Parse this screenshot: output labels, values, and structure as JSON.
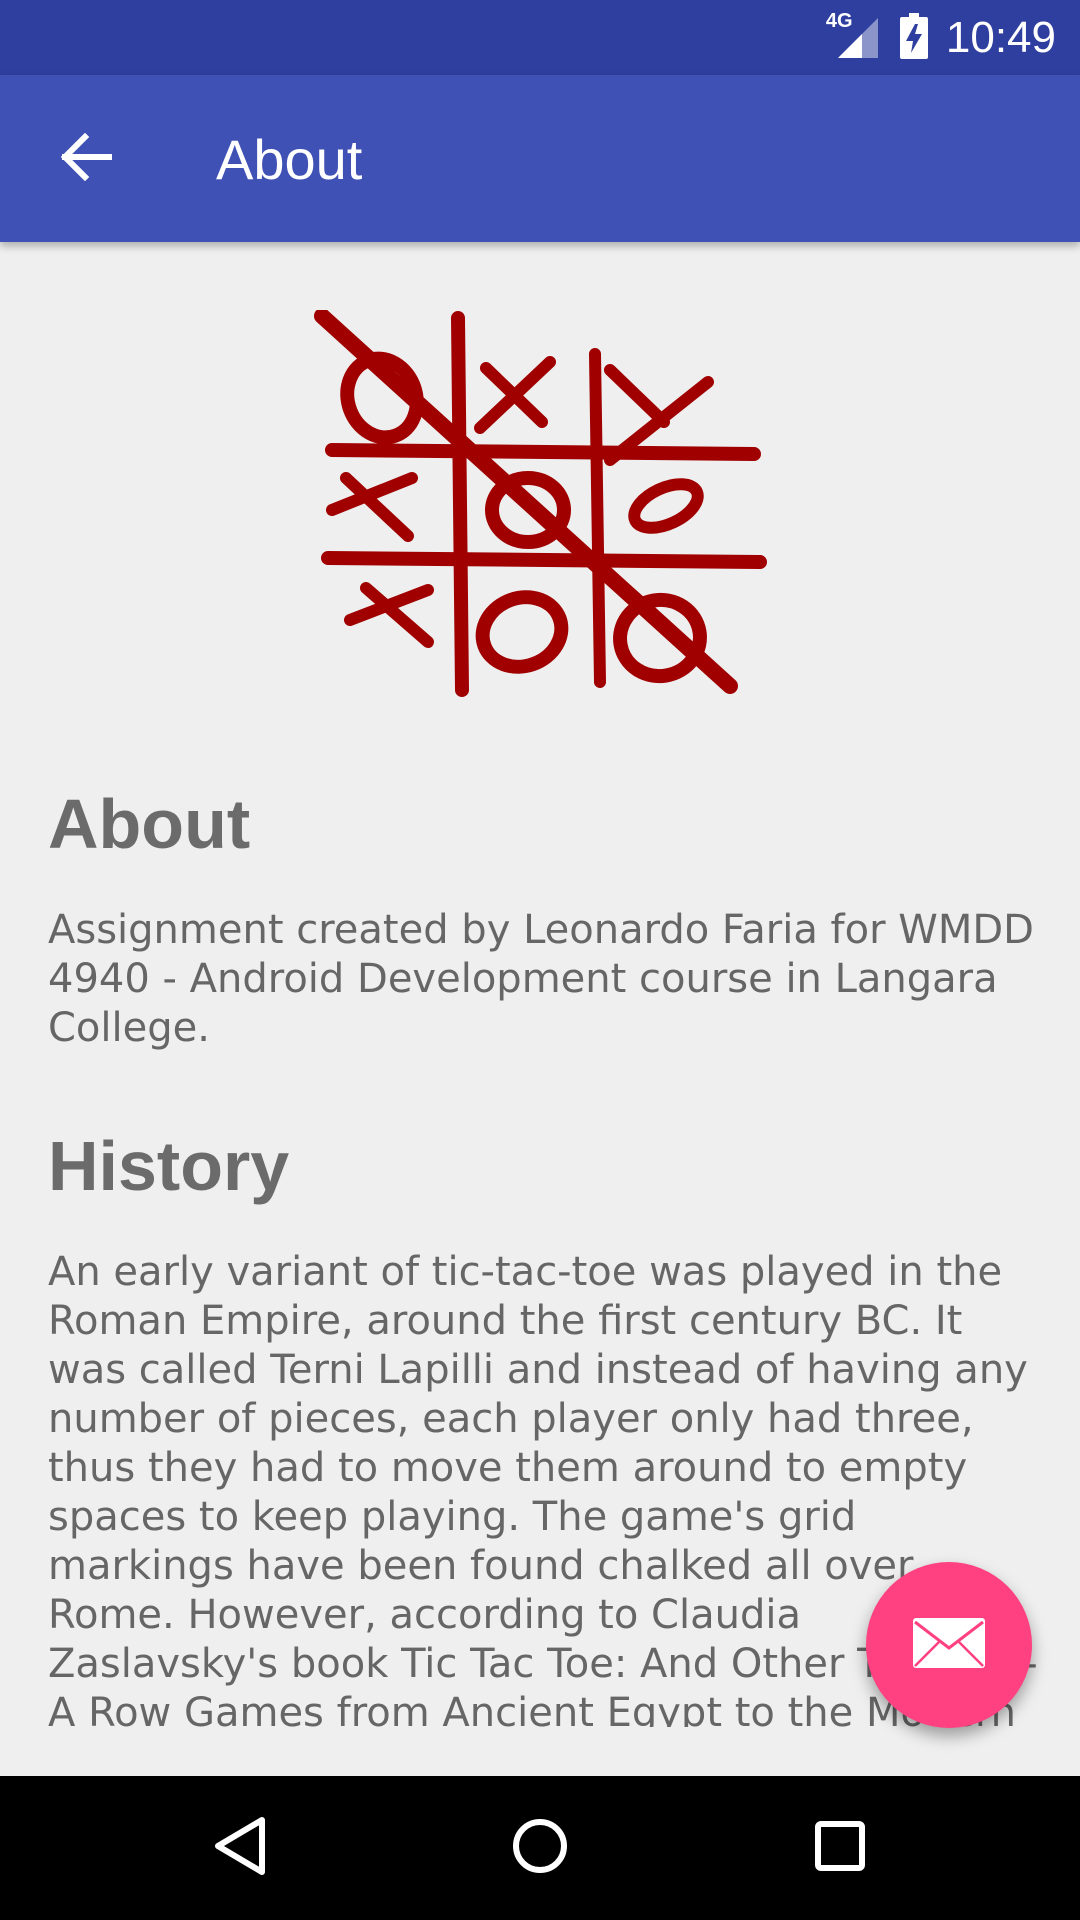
{
  "status_bar": {
    "time": "10:49",
    "network": "4G",
    "icons": [
      "signal-icon",
      "battery-icon"
    ]
  },
  "app_bar": {
    "title": "About",
    "back_icon": "arrow-back-icon"
  },
  "logo": {
    "icon": "tic-tac-toe-logo",
    "color": "#a00000"
  },
  "sections": [
    {
      "heading": "About",
      "body": "Assignment created by Leonardo Faria for WMDD 4940 - Android Development course in Langara College."
    },
    {
      "heading": "History",
      "body": "An early variant of tic-tac-toe was played in the Roman Empire, around the first century BC. It was called Terni Lapilli and instead of having any number of pieces, each player only had three, thus they had to move them around to empty spaces to keep playing. The game's grid markings have been found chalked all over Rome. However, according to Claudia Zaslavsky's book Tic Tac Toe: And Other Three-In-A Row Games from Ancient Egypt to the Modern Computer, Tic-tac-toe could originate back"
    }
  ],
  "fab": {
    "icon": "mail-icon",
    "color": "#ff4081"
  },
  "nav_bar": {
    "icons": [
      "nav-back-icon",
      "nav-home-icon",
      "nav-recents-icon"
    ]
  },
  "colors": {
    "primary": "#3f51b5",
    "primary_dark": "#2f3f9f",
    "accent": "#ff4081",
    "background": "#efefef",
    "text": "#666666"
  }
}
